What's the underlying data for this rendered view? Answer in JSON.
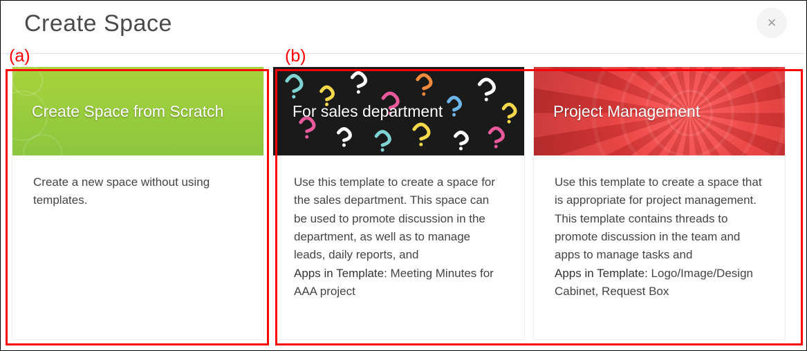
{
  "header": {
    "title": "Create Space",
    "close_glyph": "×"
  },
  "cards": [
    {
      "title": "Create Space from Scratch",
      "description": "Create a new space without using templates."
    },
    {
      "title": "For sales department",
      "description": "Use this template to create a space for the sales department. This space can be used to promote discussion in the department, as well as to manage leads, daily reports, and",
      "apps_label": "Apps in Template:  ",
      "apps_value": "Meeting Minutes for AAA project"
    },
    {
      "title": "Project Management",
      "description": "Use this template to create a space that is appropriate for project management. This template contains threads to promote discussion in the team and apps to manage tasks and",
      "apps_label": "Apps in Template:  ",
      "apps_value": "Logo/Image/Design Cabinet, Request Box"
    }
  ],
  "annotations": {
    "a": {
      "label": "(a)"
    },
    "b": {
      "label": "(b)"
    }
  }
}
